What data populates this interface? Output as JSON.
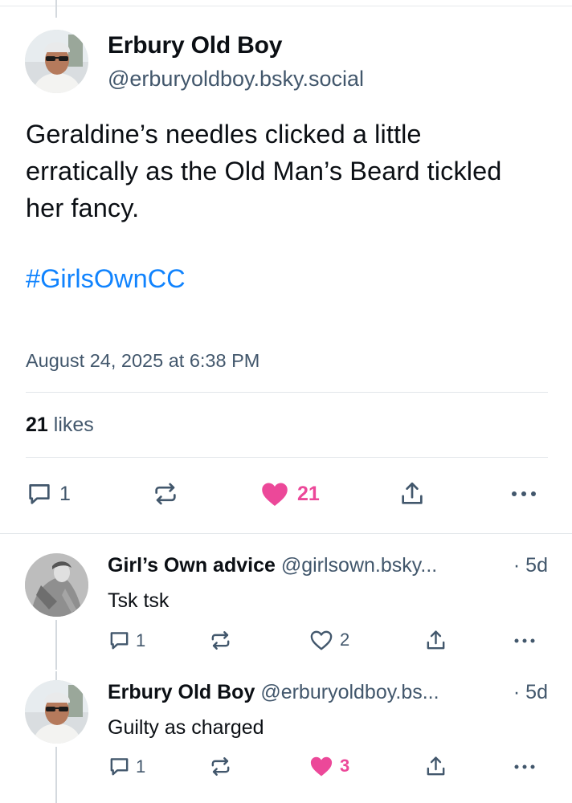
{
  "main_post": {
    "author_name": "Erbury Old Boy",
    "author_handle": "@erburyoldboy.bsky.social",
    "text": "Geraldine’s needles clicked a little erratically as the Old Man’s Beard tickled her fancy.",
    "hashtag": "#GirlsOwnCC",
    "date": "August 24, 2025 at 6:38 PM",
    "likes_count": "21",
    "likes_label": "likes",
    "actions": {
      "reply_count": "1",
      "like_count": "21"
    }
  },
  "replies": [
    {
      "author_name": "Girl’s Own advice",
      "author_handle": "@girlsown.bsky...",
      "time": "· 5d",
      "text": "Tsk tsk",
      "reply_count": "1",
      "like_count": "2",
      "liked": false
    },
    {
      "author_name": "Erbury Old Boy",
      "author_handle": "@erburyoldboy.bs...",
      "time": "· 5d",
      "text": "Guilty as charged",
      "reply_count": "1",
      "like_count": "3",
      "liked": true
    }
  ],
  "colors": {
    "text": "#0b0f14",
    "muted": "#42576c",
    "link": "#1083fe",
    "like": "#ec4899",
    "divider": "#e2e6ea"
  },
  "icons": [
    "reply-icon",
    "repost-icon",
    "heart-icon",
    "share-icon",
    "more-icon"
  ]
}
